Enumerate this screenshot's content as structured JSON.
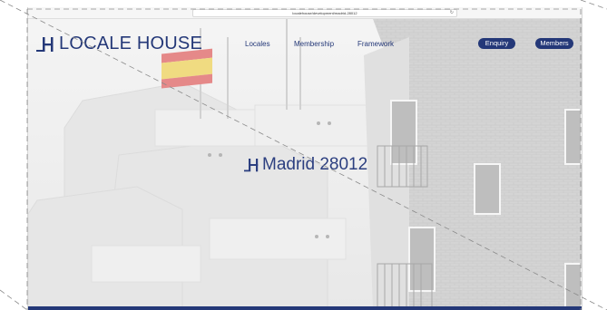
{
  "browser": {
    "url": "localehouse/development/madrid-28012",
    "reload_glyph": "↻"
  },
  "site": {
    "logo_text": "LOCALE HOUSE",
    "nav": [
      {
        "label": "Locales"
      },
      {
        "label": "Membership"
      },
      {
        "label": "Framework"
      }
    ],
    "enquiry_label": "Enquiry",
    "members_label": "Members",
    "brand_color": "#243878"
  },
  "hero": {
    "title": "Madrid 28012"
  }
}
